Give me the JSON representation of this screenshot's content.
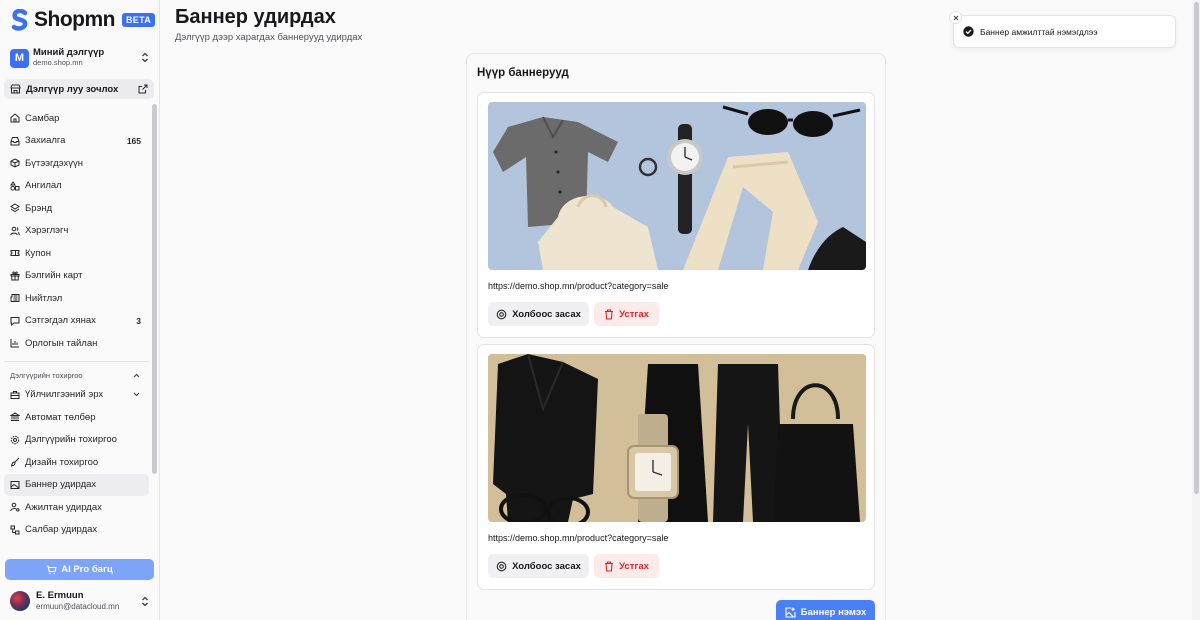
{
  "brand": {
    "name": "Shopmn",
    "badge": "BETA",
    "color": "#3b6ff5"
  },
  "store": {
    "initial": "M",
    "name": "Миний дэлгүүр",
    "domain": "demo.shop.mn"
  },
  "visit_store": "Дэлгүүр луу зочлох",
  "nav": {
    "items": [
      {
        "label": "Самбар",
        "icon": "home-icon"
      },
      {
        "label": "Захиалга",
        "icon": "inbox-icon",
        "badge": "165"
      },
      {
        "label": "Бүтээгдэхүүн",
        "icon": "package-icon"
      },
      {
        "label": "Ангилал",
        "icon": "shapes-icon"
      },
      {
        "label": "Брэнд",
        "icon": "layers-icon"
      },
      {
        "label": "Хэрэглэгч",
        "icon": "users-icon"
      },
      {
        "label": "Купон",
        "icon": "ticket-icon"
      },
      {
        "label": "Бэлгийн карт",
        "icon": "gift-icon"
      },
      {
        "label": "Нийтлэл",
        "icon": "newspaper-icon"
      },
      {
        "label": "Сэтгэгдэл хянах",
        "icon": "message-icon",
        "badge": "3"
      },
      {
        "label": "Орлогын тайлан",
        "icon": "chart-icon"
      }
    ],
    "group_label": "Дэлгүүрийн тохиргоо",
    "settings": [
      {
        "label": "Үйлчилгээний эрх",
        "icon": "briefcase-icon"
      },
      {
        "label": "Автомат төлбөр",
        "icon": "landmark-icon"
      },
      {
        "label": "Дэлгүүрийн тохиргоо",
        "icon": "gear-icon"
      },
      {
        "label": "Дизайн тохиргоо",
        "icon": "paintbrush-icon"
      },
      {
        "label": "Баннер удирдах",
        "icon": "image-icon",
        "active": true
      },
      {
        "label": "Ажилтан удирдах",
        "icon": "user-cog-icon"
      },
      {
        "label": "Салбар удирдах",
        "icon": "network-icon"
      }
    ]
  },
  "ai_button": "AI Pro багц",
  "user": {
    "name": "E. Ermuun",
    "email": "ermuun@datacloud.mn"
  },
  "page": {
    "title": "Баннер удирдах",
    "subtitle": "Дэлгүүр дээр харагдах баннерууд удирдах"
  },
  "card": {
    "title": "Нүүр баннерууд",
    "banners": [
      {
        "url": "https://demo.shop.mn/product?category=sale",
        "edit_label": "Холбоос засах",
        "delete_label": "Устгах"
      },
      {
        "url": "https://demo.shop.mn/product?category=sale",
        "edit_label": "Холбоос засах",
        "delete_label": "Устгах"
      }
    ],
    "add_label": "Баннер нэмэх"
  },
  "toast": {
    "message": "Баннер амжилттай нэмэгдлээ"
  }
}
